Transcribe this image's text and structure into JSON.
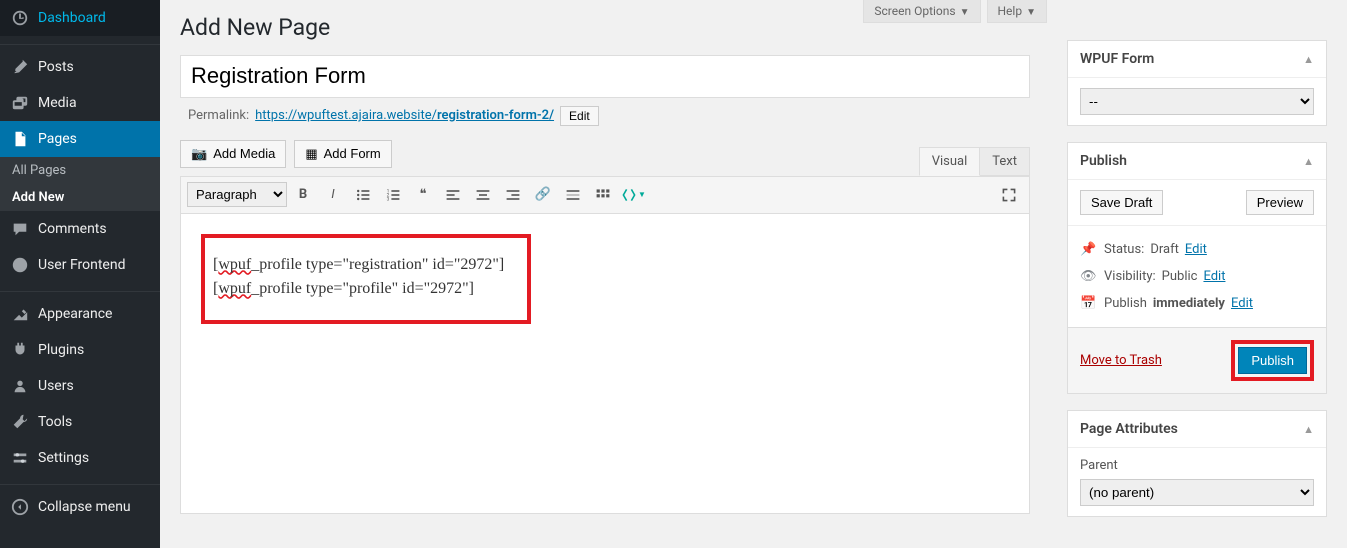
{
  "sidebar": {
    "items": [
      {
        "icon": "dashboard",
        "label": "Dashboard"
      },
      {
        "icon": "pin",
        "label": "Posts"
      },
      {
        "icon": "media",
        "label": "Media"
      },
      {
        "icon": "page",
        "label": "Pages"
      },
      {
        "icon": "comment",
        "label": "Comments"
      },
      {
        "icon": "user-frontend",
        "label": "User Frontend"
      },
      {
        "icon": "appearance",
        "label": "Appearance"
      },
      {
        "icon": "plugin",
        "label": "Plugins"
      },
      {
        "icon": "users",
        "label": "Users"
      },
      {
        "icon": "tools",
        "label": "Tools"
      },
      {
        "icon": "settings",
        "label": "Settings"
      },
      {
        "icon": "collapse",
        "label": "Collapse menu"
      }
    ],
    "sub": {
      "all": "All Pages",
      "add": "Add New"
    }
  },
  "top_tabs": {
    "screen_options": "Screen Options",
    "help": "Help"
  },
  "page_title": "Add New Page",
  "title_value": "Registration Form",
  "permalink": {
    "label": "Permalink:",
    "base": "https://wpuftest.ajaira.website/",
    "slug": "registration-form-2/",
    "edit": "Edit"
  },
  "media_buttons": {
    "add_media": "Add Media",
    "add_form": "Add Form"
  },
  "editor_tabs": {
    "visual": "Visual",
    "text": "Text"
  },
  "paragraph_select": "Paragraph",
  "content": {
    "line1_a": "[",
    "line1_b": "wpuf",
    "line1_c": "_profile type=\"registration\" id=\"2972\"]",
    "line2_a": "[",
    "line2_b": "wpuf",
    "line2_c": "_profile type=\"profile\" id=\"2972\"]"
  },
  "panels": {
    "wpuf_form": {
      "title": "WPUF Form",
      "selected": "--"
    },
    "publish": {
      "title": "Publish",
      "save_draft": "Save Draft",
      "preview": "Preview",
      "status_label": "Status:",
      "status_value": "Draft",
      "status_edit": "Edit",
      "visibility_label": "Visibility:",
      "visibility_value": "Public",
      "visibility_edit": "Edit",
      "schedule_label": "Publish",
      "schedule_value": "immediately",
      "schedule_edit": "Edit",
      "trash": "Move to Trash",
      "publish_btn": "Publish"
    },
    "attributes": {
      "title": "Page Attributes",
      "parent_label": "Parent",
      "parent_value": "(no parent)"
    }
  }
}
